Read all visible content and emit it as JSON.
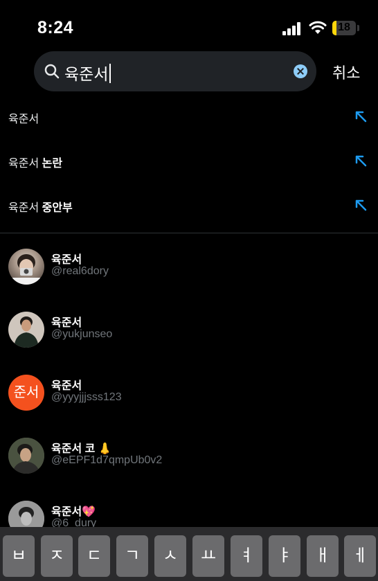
{
  "status_bar": {
    "time": "8:24",
    "battery": "18",
    "battery_level": 0.18
  },
  "search": {
    "query": "육준서",
    "cancel_label": "취소"
  },
  "suggestions": [
    {
      "base": "육준서",
      "suffix": ""
    },
    {
      "base": "육준서",
      "suffix": " 논란"
    },
    {
      "base": "육준서",
      "suffix": " 중안부"
    }
  ],
  "users": [
    {
      "name": "육준서",
      "handle": "@real6dory",
      "avatar": "photo"
    },
    {
      "name": "육준서",
      "handle": "@yukjunseo",
      "avatar": "photo"
    },
    {
      "name": "육준서",
      "handle": "@yyyjjjsss123",
      "avatar": "text",
      "avatar_text": "준서",
      "avatar_color": "#f4511e"
    },
    {
      "name": "육준서 코 👃",
      "handle": "@eEPF1d7qmpUb0v2",
      "avatar": "photo"
    },
    {
      "name": "육준서💖",
      "handle": "@6_dury",
      "avatar": "photo"
    }
  ],
  "keyboard": {
    "keys": [
      "ㅂ",
      "ㅈ",
      "ㄷ",
      "ㄱ",
      "ㅅ",
      "ㅛ",
      "ㅕ",
      "ㅑ",
      "ㅐ",
      "ㅔ"
    ]
  },
  "colors": {
    "accent": "#1d9bf0",
    "background": "#000000",
    "search_bg": "#202327",
    "secondary_text": "#71767b"
  }
}
